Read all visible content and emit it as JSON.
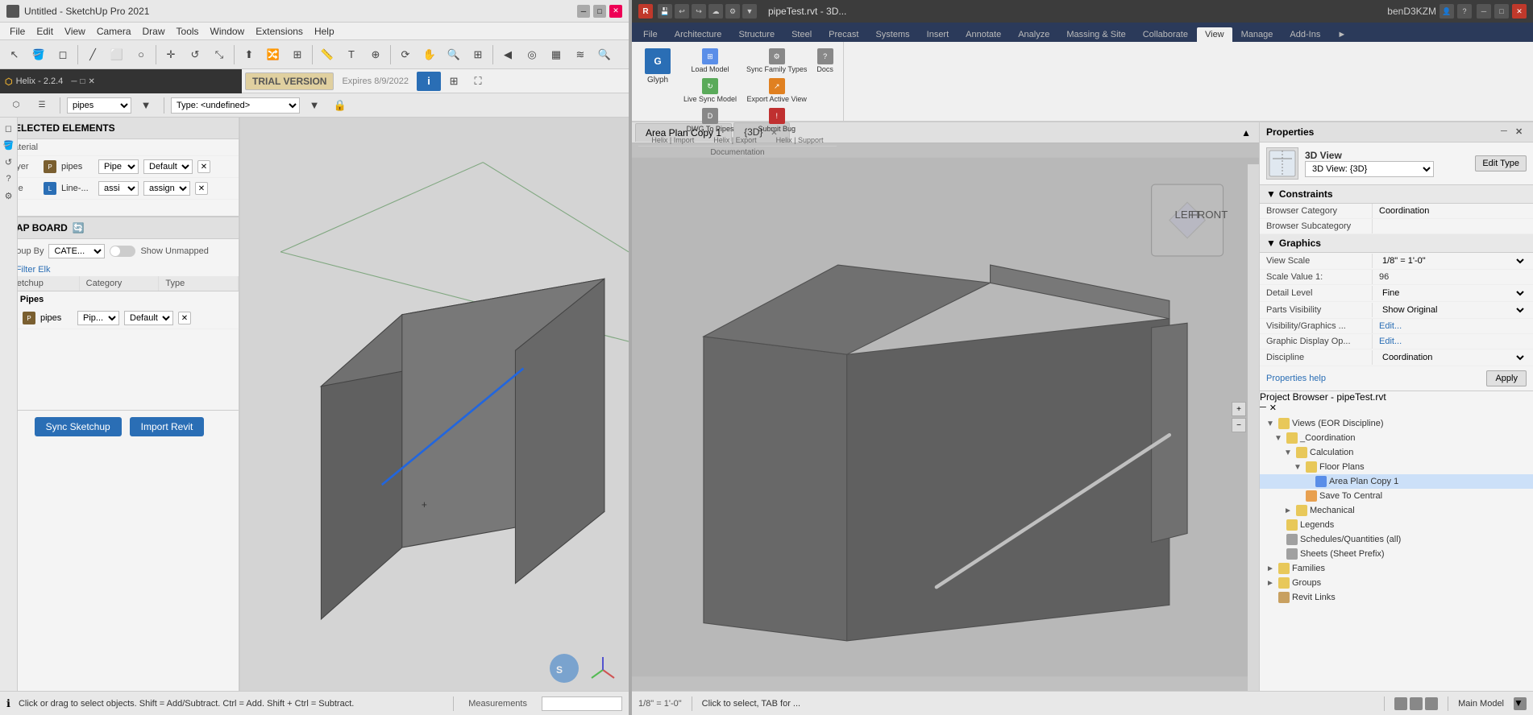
{
  "sketchup": {
    "titlebar": {
      "title": "Untitled - SketchUp Pro 2021",
      "minimize": "─",
      "maximize": "□",
      "close": "✕"
    },
    "menubar": [
      "File",
      "Edit",
      "View",
      "Camera",
      "Draw",
      "Tools",
      "Window",
      "Extensions",
      "Help"
    ],
    "helix": {
      "version": "Helix - 2.2.4",
      "trial": "TRIAL VERSION",
      "expires": "Expires 8/9/2022"
    },
    "type_bar": {
      "layer": "pipes",
      "type_label": "Type: <undefined>"
    },
    "left_panel": {
      "selected_elements_label": "SELECTED ELEMENTS",
      "material_label": "Material",
      "layer_label": "Layer",
      "layer_icon_label": "P",
      "layer_name": "pipes",
      "layer_type": "Pipe",
      "layer_default": "Default",
      "line_label": "Line",
      "line_icon_label": "L",
      "line_name": "Line-...",
      "line_assign1": "assi",
      "line_assign2": "assign",
      "mapboard_label": "MAP BOARD",
      "group_by_label": "Group By",
      "group_by_value": "CATE...",
      "show_unmapped": "Show Unmapped",
      "filter_label": "Filter Elk",
      "sketchup_col": "Sketchup Name",
      "category_col": "Category",
      "type_col": "Type",
      "pipes_category": "Pipes",
      "pipes_icon_label": "P",
      "pipes_name": "pipes",
      "pipes_type": "Pip...",
      "pipes_default": "Default",
      "sync_sketchup": "Sync Sketchup",
      "import_revit": "Import Revit"
    },
    "status": {
      "info_icon": "ℹ",
      "message": "Click or drag to select objects. Shift = Add/Subtract. Ctrl = Add. Shift + Ctrl = Subtract.",
      "measurements": "Measurements"
    }
  },
  "revit": {
    "titlebar": {
      "title": "pipeTest.rvt - 3D...",
      "user": "benD3KZM",
      "minimize": "─",
      "maximize": "□",
      "close": "✕"
    },
    "tabs": [
      "File",
      "Architecture",
      "Structure",
      "Steel",
      "Precast",
      "Systems",
      "Insert",
      "Annotate",
      "Analyze",
      "Massing & Site",
      "Collaborate",
      "View",
      "Manage",
      "Add-Ins",
      "►"
    ],
    "active_tab": "File",
    "ribbon": {
      "panels": [
        {
          "label": "Documentation",
          "buttons": [
            {
              "label": "Glyph",
              "icon": "G"
            },
            {
              "label": "Load Model",
              "icon": "⊞"
            },
            {
              "label": "Live Sync Model",
              "icon": "↻"
            },
            {
              "label": "DWG To Pipes",
              "icon": "⬜"
            },
            {
              "label": "Sync Family Types",
              "icon": "⚙"
            },
            {
              "label": "Export Active View",
              "icon": "↗"
            },
            {
              "label": "Submit Bug",
              "icon": "🐛"
            },
            {
              "label": "Docs",
              "icon": "?"
            }
          ]
        }
      ],
      "helix_import": "Helix | Import",
      "helix_export": "Helix | Export",
      "helix_support": "Helix | Support"
    },
    "views": {
      "tabs": [
        {
          "label": "Area Plan Copy 1",
          "active": false
        },
        {
          "label": "{3D}",
          "active": true
        }
      ]
    },
    "properties": {
      "panel_label": "Properties",
      "type_icon": "3D",
      "type_name": "3D View",
      "type_select": "3D View: {3D}",
      "edit_type": "Edit Type",
      "sections": [
        {
          "name": "Constraints",
          "rows": [
            {
              "key": "Browser Category",
              "val": "Coordination"
            },
            {
              "key": "Browser Subcategory",
              "val": ""
            }
          ]
        },
        {
          "name": "Graphics",
          "rows": [
            {
              "key": "View Scale",
              "val": "1/8\" = 1'-0\""
            },
            {
              "key": "Scale Value 1:",
              "val": "96"
            },
            {
              "key": "Detail Level",
              "val": "Fine"
            },
            {
              "key": "Parts Visibility",
              "val": "Show Original"
            },
            {
              "key": "Visibility/Graphics ...",
              "val": "Edit...",
              "link": true
            },
            {
              "key": "Graphic Display Op...",
              "val": "Edit...",
              "link": true
            },
            {
              "key": "Discipline",
              "val": "Coordination"
            }
          ]
        }
      ],
      "apply_btn": "Apply",
      "properties_help": "Properties help"
    },
    "project_browser": {
      "label": "Project Browser - pipeTest.rvt",
      "tree": [
        {
          "level": 0,
          "expand": "▼",
          "icon": "folder",
          "label": "Views (EOR Discipline)"
        },
        {
          "level": 1,
          "expand": "▼",
          "icon": "folder",
          "label": "_Coordination"
        },
        {
          "level": 2,
          "expand": "▼",
          "icon": "folder",
          "label": "Calculation"
        },
        {
          "level": 3,
          "expand": "▼",
          "icon": "folder",
          "label": "Floor Plans"
        },
        {
          "level": 4,
          "expand": "─",
          "icon": "view",
          "label": "Area Plan Copy 1",
          "selected": true
        },
        {
          "level": 3,
          "expand": "─",
          "icon": "folder",
          "label": "Save To Central"
        },
        {
          "level": 2,
          "expand": "►",
          "icon": "folder",
          "label": "Mechanical"
        },
        {
          "level": 1,
          "expand": "─",
          "icon": "folder",
          "label": "Legends"
        },
        {
          "level": 1,
          "expand": "─",
          "icon": "folder",
          "label": "Schedules/Quantities (all)"
        },
        {
          "level": 1,
          "expand": "─",
          "icon": "folder",
          "label": "Sheets (Sheet Prefix)"
        },
        {
          "level": 0,
          "expand": "►",
          "icon": "folder",
          "label": "Families"
        },
        {
          "level": 0,
          "expand": "►",
          "icon": "folder",
          "label": "Groups"
        },
        {
          "level": 0,
          "expand": "─",
          "icon": "folder",
          "label": "Revit Links"
        }
      ]
    },
    "status": {
      "scale": "1/8\" = 1'-0\"",
      "info": "Click to select, TAB for ...",
      "model": "Main Model"
    }
  }
}
